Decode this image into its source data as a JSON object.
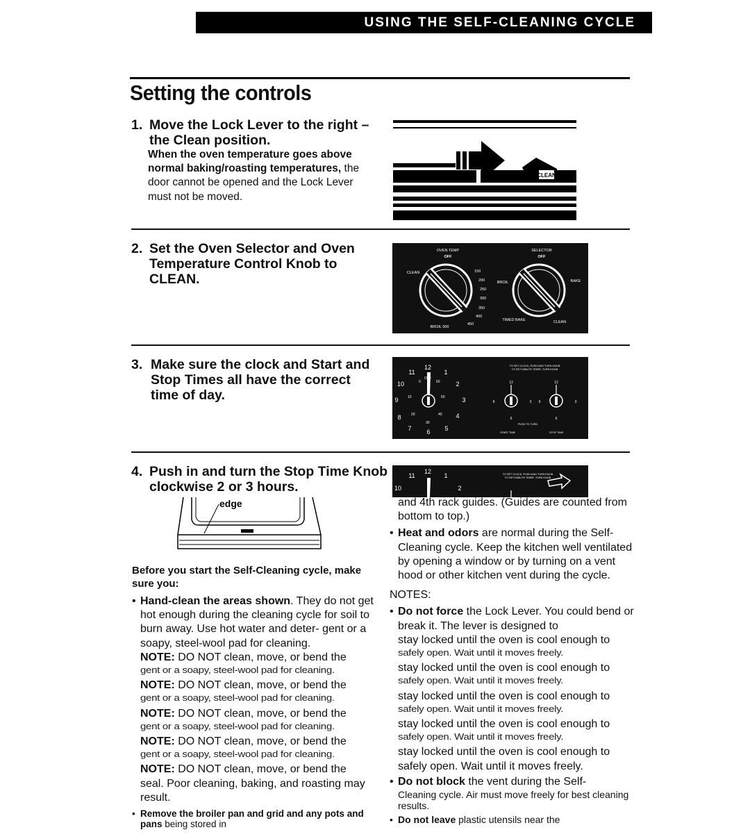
{
  "header": {
    "section_title": "USING THE SELF-CLEANING CYCLE"
  },
  "page_title": "Setting the controls",
  "steps": [
    {
      "number": "1.",
      "heading": "Move the Lock Lever to the right – the Clean position.",
      "body_bold": "When the oven temperature goes above normal baking/roasting temperatures,",
      "body_rest": " the door cannot be opened and the Lock Lever must not be moved."
    },
    {
      "number": "2.",
      "heading": "Set the Oven Selector and Oven Temperature Control Knob to CLEAN."
    },
    {
      "number": "3.",
      "heading": "Make sure the clock and Start and Stop Times all have the correct time of day."
    },
    {
      "number": "4.",
      "heading": "Push in and turn the Stop Time Knob clockwise 2 or 3 hours."
    }
  ],
  "illustrations": {
    "lock_lever": {
      "label": "CLEAN"
    },
    "knobs": {
      "oven_temp_label": "OVEN TEMP",
      "selector_label": "SELECTOR",
      "off": "OFF",
      "clean": "CLEAN",
      "temps": [
        "150",
        "200",
        "250",
        "300",
        "350",
        "400",
        "450"
      ],
      "broil_500": "BROIL 500",
      "broil": "BROIL",
      "bake": "BAKE",
      "timed_bake": "TIMED BAKE"
    },
    "clock": {
      "hours": [
        "12",
        "1",
        "2",
        "3",
        "4",
        "5",
        "6",
        "7",
        "8",
        "9",
        "10",
        "11"
      ],
      "minutes": [
        "0",
        "10",
        "20",
        "30",
        "40",
        "50",
        "60"
      ],
      "off": "OFF",
      "instructions_1": "TO SET CLOCK, PUSH AND TURN KNOB",
      "instructions_2": "TO SET MINUTE TIMER, TURN KNOB",
      "push_to_turn": "PUSH TO TURN",
      "start_time": "START TIME",
      "stop_time": "STOP TIME",
      "dial_12": "12",
      "dial_3": "3",
      "dial_6": "6",
      "dial_9": "9"
    },
    "oven_door": {
      "edge_label": "edge"
    }
  },
  "left_column": {
    "intro": "Before you start the Self-Cleaning cycle, make sure you:",
    "bullet1_bold": "Hand-clean the areas shown",
    "bullet1_rest": ". They do not get hot enough during the cleaning cycle for soil to burn away. Use hot water and deter- gent or a soapy, steel-wool pad for cleaning.",
    "note_label": "NOTE:",
    "note_text": " DO NOT clean, move, or bend the",
    "note_garbled": "gent or a soapy, steel-wool pad for cleaning.",
    "note_final": "seal. Poor cleaning, baking, and roasting may result.",
    "bullet2_bold": "Remove the broiler pan and grid and any pots and pans",
    "bullet2_rest": " being stored in"
  },
  "right_column": {
    "rack_text": "and 4th rack guides. (Guides are counted from bottom to top.)",
    "heat_bold": "Heat and odors",
    "heat_rest": " are normal during the Self-Cleaning cycle. Keep the kitchen well ventilated by opening a window or by turning on a vent hood or other kitchen vent during the cycle.",
    "notes_heading": "NOTES:",
    "force_bold": "Do not force",
    "force_rest": " the Lock Lever. You could bend or break it. The lever is designed to",
    "stay_locked": "stay locked until the oven is cool enough to",
    "safely_open_garbled": "safely open. Wait until it moves freely.",
    "safely_open": "safely open. Wait until it moves freely.",
    "block_bold": "Do not block",
    "block_rest_1": " the vent during the Self-",
    "block_rest_2": "Cleaning cycle. Air must move freely for best cleaning results.",
    "leave_bold": "Do not leave",
    "leave_rest": " plastic utensils near the"
  }
}
